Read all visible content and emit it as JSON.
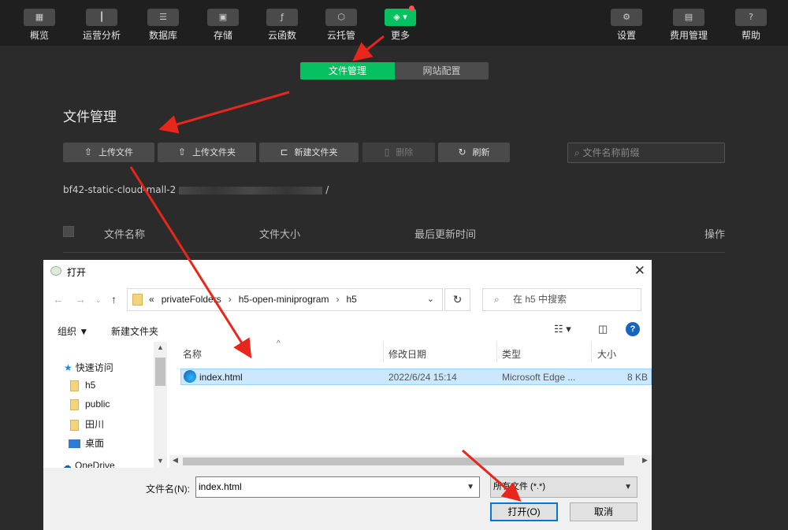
{
  "nav": {
    "left": [
      {
        "label": "概览",
        "icon": "grid-icon",
        "glyph": "▦"
      },
      {
        "label": "运营分析",
        "icon": "bar-chart-icon",
        "glyph": "┃"
      },
      {
        "label": "数据库",
        "icon": "database-icon",
        "glyph": "☰"
      },
      {
        "label": "存储",
        "icon": "save-icon",
        "glyph": "▣"
      },
      {
        "label": "云函数",
        "icon": "function-icon",
        "glyph": "ƒ"
      },
      {
        "label": "云托管",
        "icon": "cube-icon",
        "glyph": "⬡"
      },
      {
        "label": "更多",
        "icon": "layers-icon",
        "glyph": "◈ ▾"
      }
    ],
    "right": [
      {
        "label": "设置",
        "icon": "gear-icon",
        "glyph": "⚙"
      },
      {
        "label": "费用管理",
        "icon": "billing-icon",
        "glyph": "▤"
      },
      {
        "label": "帮助",
        "icon": "help-icon",
        "glyph": "?"
      }
    ]
  },
  "tabs": {
    "file_manage": "文件管理",
    "site_config": "网站配置"
  },
  "page": {
    "title": "文件管理",
    "toolbar": {
      "upload_file": "上传文件",
      "upload_folder": "上传文件夹",
      "new_folder": "新建文件夹",
      "delete": "删除",
      "refresh": "刷新"
    },
    "search_placeholder": "文件名称前缀",
    "path_prefix": "bf42-static-cloud-mall-2",
    "path_suffix": "/",
    "columns": {
      "name": "文件名称",
      "size": "文件大小",
      "updated": "最后更新时间",
      "action": "操作"
    }
  },
  "dialog": {
    "title": "打开",
    "crumbs": [
      "«",
      "privateFolders",
      "›",
      "h5-open-miniprogram",
      "›",
      "h5"
    ],
    "search_placeholder": "在 h5 中搜索",
    "organize": "组织 ▼",
    "new_folder": "新建文件夹",
    "sidebar": {
      "quick_access": "快速访问",
      "items": [
        "h5",
        "public",
        "田川"
      ],
      "desktop": "桌面",
      "onedrive": "OneDrive"
    },
    "columns": {
      "name": "名称",
      "modified": "修改日期",
      "type": "类型",
      "size": "大小"
    },
    "file": {
      "name": "index.html",
      "modified": "2022/6/24 15:14",
      "type": "Microsoft Edge ...",
      "size": "8 KB"
    },
    "filename_label": "文件名(N):",
    "filename_value": "index.html",
    "filetype_value": "所有文件 (*.*)",
    "open_button": "打开(O)",
    "cancel_button": "取消"
  },
  "colors": {
    "accent": "#07c160",
    "annotation": "#e8261b",
    "selection": "#cce8ff"
  }
}
